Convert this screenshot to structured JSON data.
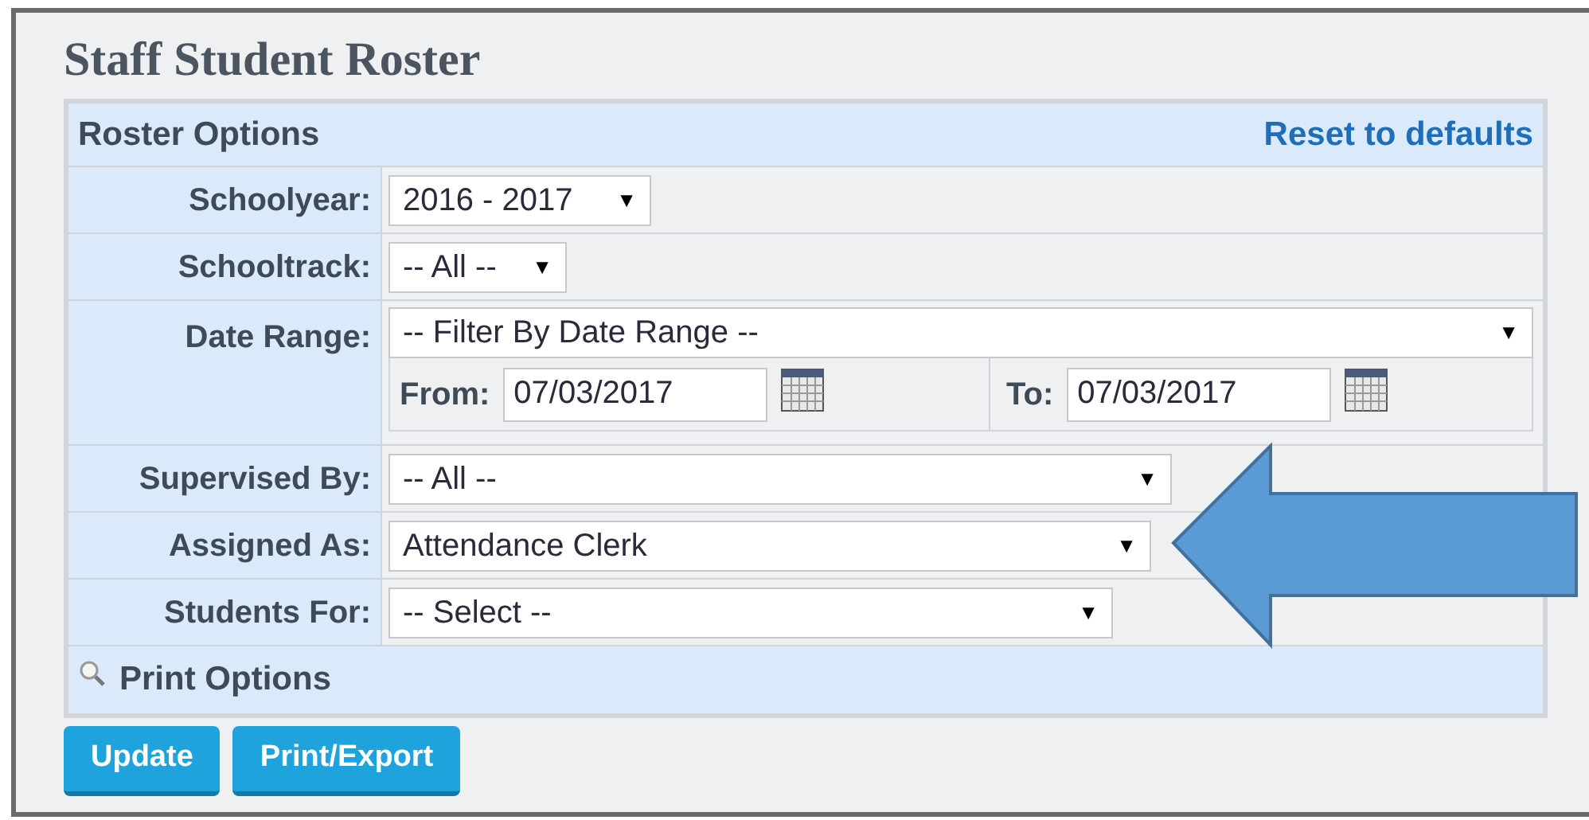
{
  "title": "Staff Student Roster",
  "options": {
    "heading": "Roster Options",
    "reset_link": "Reset to defaults"
  },
  "fields": [
    {
      "kind": "select",
      "label": "Schoolyear:",
      "value": "2016 - 2017",
      "arrow": "▼"
    },
    {
      "kind": "select",
      "label": "Schooltrack:",
      "value": "-- All --",
      "arrow": "▼"
    },
    {
      "kind": "daterange",
      "label": "Date Range:",
      "value": "-- Filter By Date Range --",
      "arrow": "▼",
      "from_label": "From:",
      "from_value": "07/03/2017",
      "to_label": "To:",
      "to_value": "07/03/2017"
    },
    {
      "kind": "select",
      "label": "Supervised By:",
      "value": "-- All --",
      "arrow": "▼"
    },
    {
      "kind": "select",
      "label": "Assigned As:",
      "value": "Attendance Clerk",
      "arrow": "▼"
    },
    {
      "kind": "select",
      "label": "Students For:",
      "value": "-- Select --",
      "arrow": "▼"
    }
  ],
  "print_options": {
    "label": "Print Options"
  },
  "buttons": [
    "Update",
    "Print/Export"
  ]
}
